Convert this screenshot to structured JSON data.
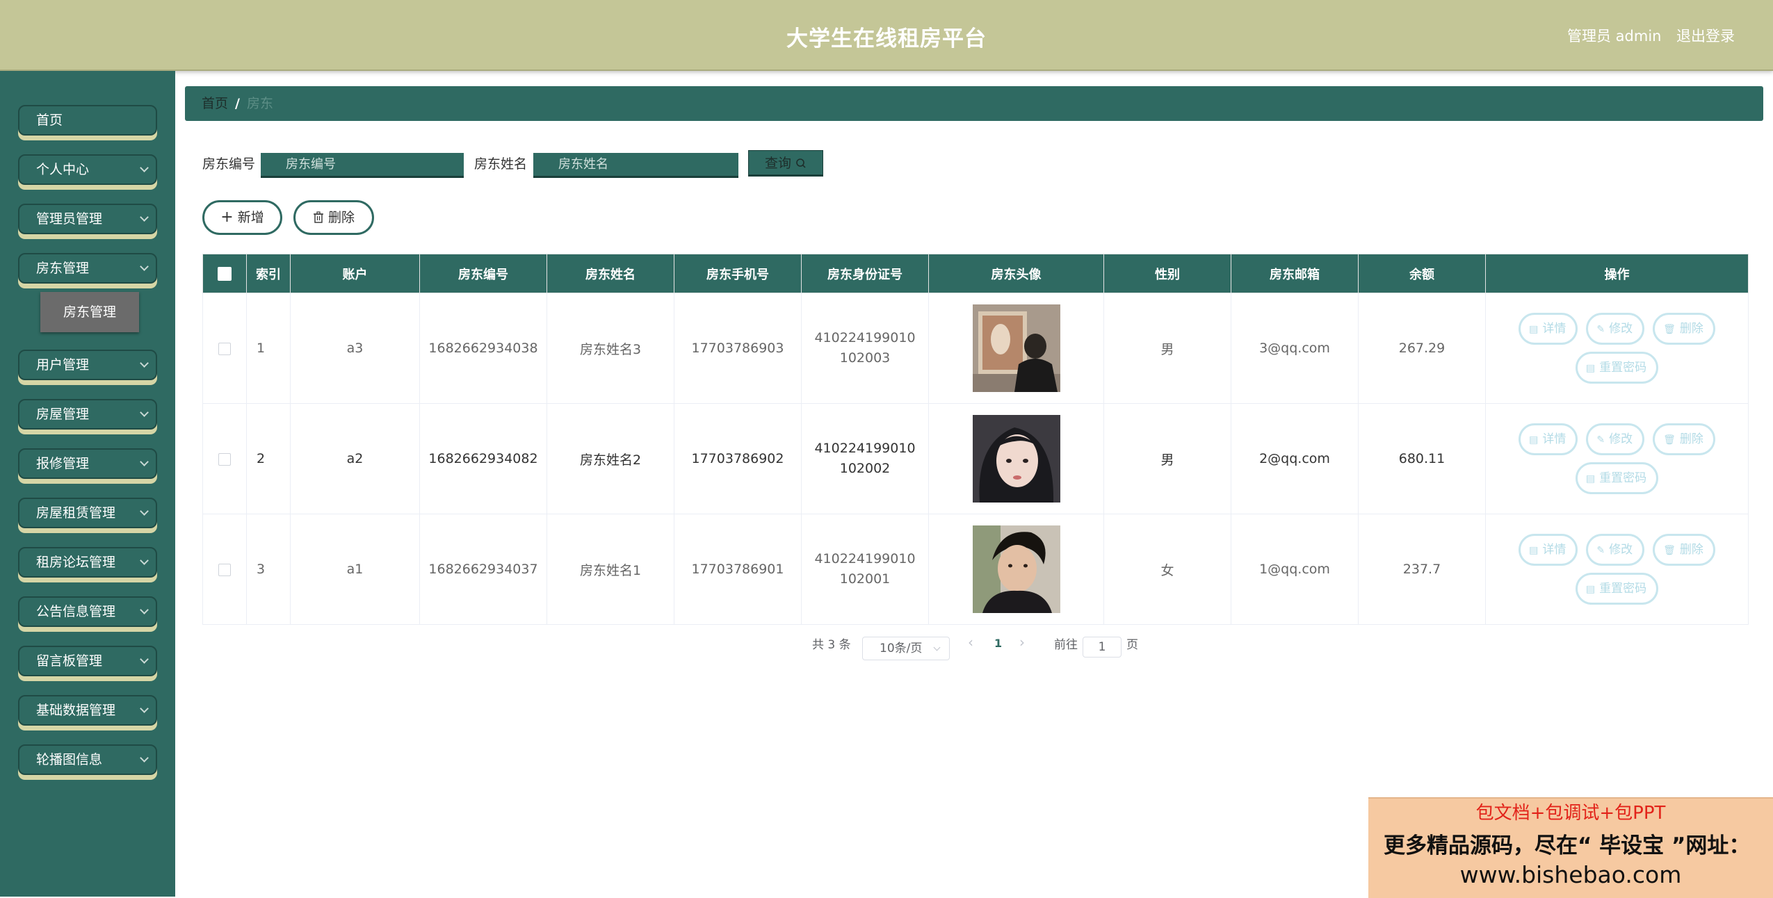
{
  "header": {
    "title": "大学生在线租房平台",
    "user_label": "管理员 admin",
    "logout_label": "退出登录"
  },
  "sidebar": {
    "items": [
      {
        "label": "首页",
        "has_dropdown": false
      },
      {
        "label": "个人中心",
        "has_dropdown": true
      },
      {
        "label": "管理员管理",
        "has_dropdown": true
      },
      {
        "label": "房东管理",
        "has_dropdown": true,
        "expanded": true
      },
      {
        "label": "用户管理",
        "has_dropdown": true
      },
      {
        "label": "房屋管理",
        "has_dropdown": true
      },
      {
        "label": "报修管理",
        "has_dropdown": true
      },
      {
        "label": "房屋租赁管理",
        "has_dropdown": true
      },
      {
        "label": "租房论坛管理",
        "has_dropdown": true
      },
      {
        "label": "公告信息管理",
        "has_dropdown": true
      },
      {
        "label": "留言板管理",
        "has_dropdown": true
      },
      {
        "label": "基础数据管理",
        "has_dropdown": true
      },
      {
        "label": "轮播图信息",
        "has_dropdown": true
      }
    ],
    "submenu_label": "房东管理"
  },
  "breadcrumb": {
    "home": "首页",
    "separator": "/",
    "current": "房东"
  },
  "search": {
    "field1_label": "房东编号",
    "field1_placeholder": "房东编号",
    "field2_label": "房东姓名",
    "field2_placeholder": "房东姓名",
    "query_label": "查询",
    "query_icon": "search-icon"
  },
  "actions": {
    "add_label": "新增",
    "add_icon": "plus-icon",
    "delete_label": "删除",
    "delete_icon": "trash-icon"
  },
  "table": {
    "headers": [
      "索引",
      "账户",
      "房东编号",
      "房东姓名",
      "房东手机号",
      "房东身份证号",
      "房东头像",
      "性别",
      "房东邮箱",
      "余额",
      "操作"
    ],
    "rows": [
      {
        "index": "1",
        "account": "a3",
        "number": "1682662934038",
        "name": "房东姓名3",
        "phone": "17703786903",
        "idcard": "410224199010102003",
        "avatar": "landlord-photo-1",
        "gender": "男",
        "email": "3@qq.com",
        "balance": "267.29"
      },
      {
        "index": "2",
        "account": "a2",
        "number": "1682662934082",
        "name": "房东姓名2",
        "phone": "17703786902",
        "idcard": "410224199010102002",
        "avatar": "landlord-photo-2",
        "gender": "男",
        "email": "2@qq.com",
        "balance": "680.11"
      },
      {
        "index": "3",
        "account": "a1",
        "number": "1682662934037",
        "name": "房东姓名1",
        "phone": "17703786901",
        "idcard": "410224199010102001",
        "avatar": "landlord-photo-3",
        "gender": "女",
        "email": "1@qq.com",
        "balance": "237.7"
      }
    ],
    "row_actions": {
      "detail": "详情",
      "edit": "修改",
      "delete": "删除",
      "reset": "重置密码"
    }
  },
  "pagination": {
    "total_text": "共 3 条",
    "page_size": "10条/页",
    "current_page": "1",
    "goto_label": "前往",
    "goto_value": "1",
    "page_suffix": "页"
  },
  "watermark": {
    "line1": "包文档+包调试+包PPT",
    "line2": "更多精品源码，尽在“ 毕设宝 ”网址：",
    "line3": "www.bishebao.com"
  },
  "colors": {
    "header_bg": "#c4c697",
    "primary": "#2f6a62",
    "menu_shadow": "#d6d6a6",
    "op_button": "#b3dbe6",
    "watermark_bg": "#f6c9a1",
    "watermark_accent": "#e2231a"
  }
}
